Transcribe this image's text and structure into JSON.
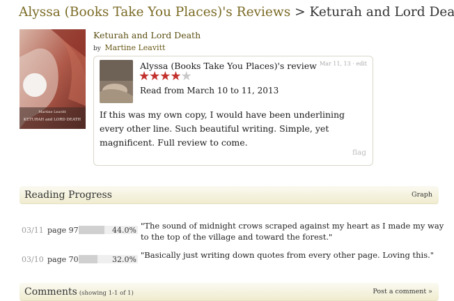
{
  "breadcrumb": {
    "parent": "Alyssa (Books Take You Places)'s Reviews",
    "separator": ">",
    "current": "Keturah and Lord Death"
  },
  "book": {
    "title": "Keturah and Lord Death",
    "by": "by",
    "author": "Martine Leavitt",
    "cover_text": {
      "author": "Martine Leavitt",
      "title": "KETURAH and LORD DEATH"
    }
  },
  "review": {
    "reviewer": "Alyssa (Books Take You Places)'s review",
    "date": "Mar 11, 13",
    "meta_sep": "·",
    "edit_label": "edit",
    "rating": 4,
    "max_rating": 5,
    "read_dates": "Read from March 10 to 11, 2013",
    "body": "If this was my own copy, I would have been underlining every other line. Such beautiful writing. Simple, yet magnificent. Full review to come.",
    "flag_label": "flag"
  },
  "reading_progress": {
    "title": "Reading Progress",
    "graph_label": "Graph",
    "entries": [
      {
        "date": "03/11",
        "page": "page 97",
        "percent": "44.0%",
        "fraction": 0.44,
        "quote": "\"The sound of midnight crows scraped against my heart as I made my way",
        "quote_line2": "to the top of the village and toward the forest.\""
      },
      {
        "date": "03/10",
        "page": "page 70",
        "percent": "32.0%",
        "fraction": 0.32,
        "quote": "\"Basically just writing down quotes from every other page. Loving this.\"",
        "quote_line2": ""
      }
    ]
  },
  "comments": {
    "title": "Comments",
    "showing": "(showing 1-1 of 1)",
    "post_label": "Post a comment »"
  },
  "colors": {
    "link": "#7a6a24",
    "star": "#c2312d",
    "section_bg": "#efeccf"
  }
}
